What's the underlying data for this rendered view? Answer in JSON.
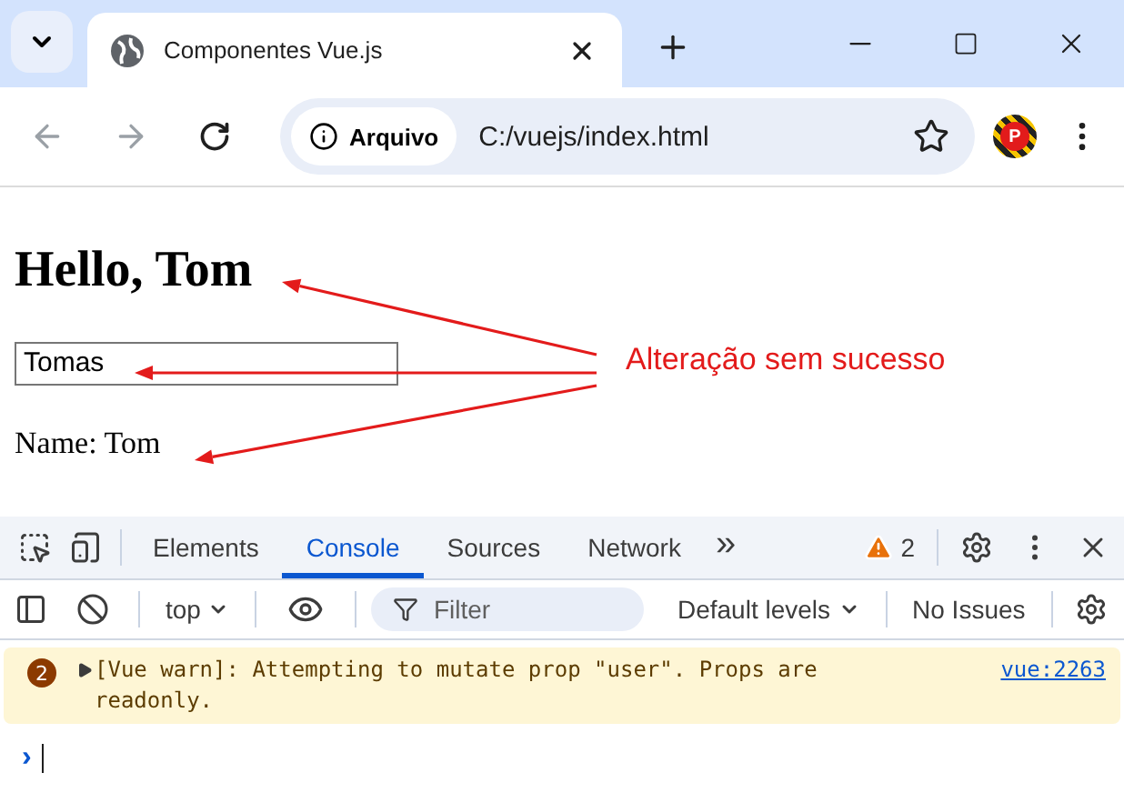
{
  "browser_tab": {
    "title": "Componentes Vue.js"
  },
  "profile": {
    "initial": "P"
  },
  "address_bar": {
    "security_label": "Arquivo",
    "url": "C:/vuejs/index.html"
  },
  "page": {
    "heading": "Hello, Tom",
    "input_value": "Tomas",
    "name_line": "Name: Tom"
  },
  "annotation": {
    "text": "Alteração sem sucesso"
  },
  "devtools": {
    "tabs": [
      {
        "label": "Elements",
        "selected": false
      },
      {
        "label": "Console",
        "selected": true
      },
      {
        "label": "Sources",
        "selected": false
      },
      {
        "label": "Network",
        "selected": false
      }
    ],
    "more_tabs": "»",
    "warning_count": "2",
    "context": "top",
    "filter_placeholder": "Filter",
    "levels": "Default levels",
    "issues": "No Issues",
    "messages": [
      {
        "kind": "warning",
        "count": "2",
        "text": "[Vue warn]: Attempting to mutate prop \"user\". Props are",
        "link": "vue:2263",
        "continuation": "readonly."
      }
    ],
    "prompt": "›"
  }
}
